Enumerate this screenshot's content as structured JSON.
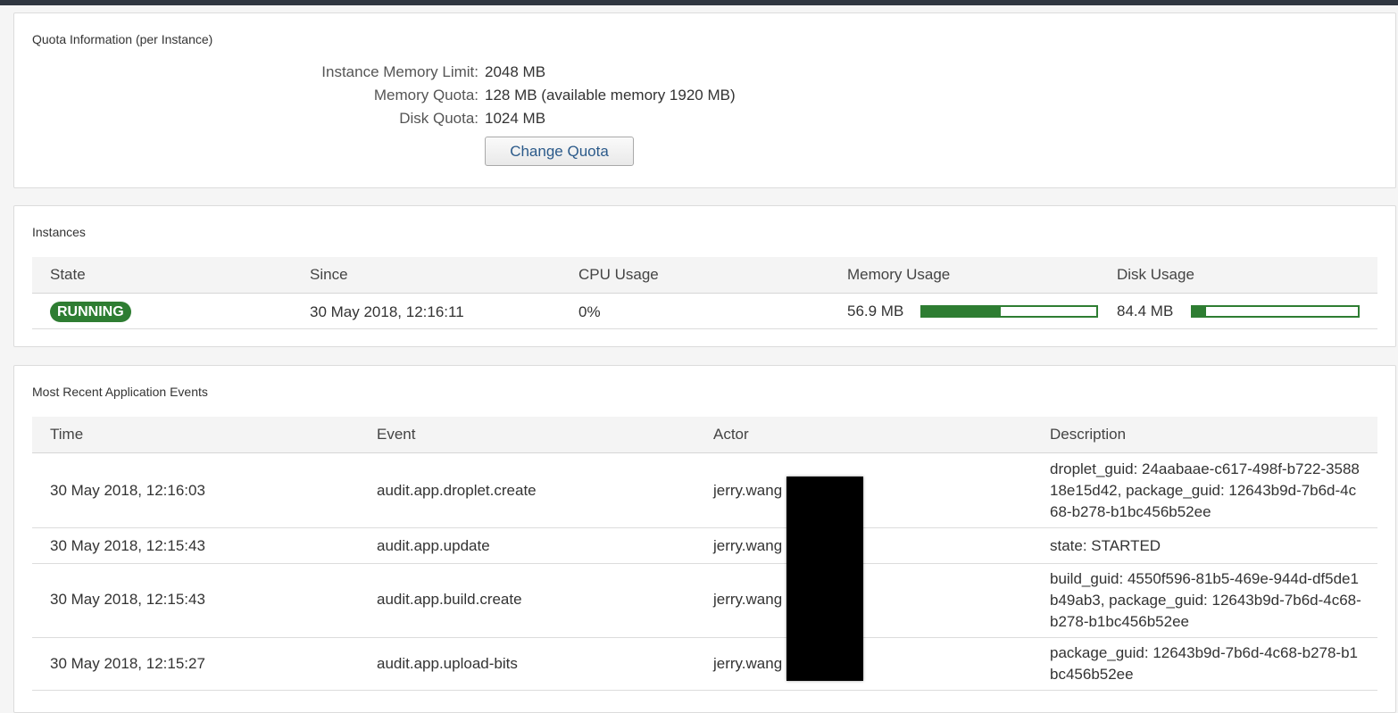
{
  "quota": {
    "title": "Quota Information (per Instance)",
    "rows": [
      {
        "label": "Instance Memory Limit:",
        "value": "2048 MB"
      },
      {
        "label": "Memory Quota:",
        "value": "128 MB (available memory 1920 MB)"
      },
      {
        "label": "Disk Quota:",
        "value": "1024 MB"
      }
    ],
    "change_button": "Change Quota"
  },
  "instances": {
    "title": "Instances",
    "columns": [
      "State",
      "Since",
      "CPU Usage",
      "Memory Usage",
      "Disk Usage"
    ],
    "rows": [
      {
        "state": "RUNNING",
        "since": "30 May 2018, 12:16:11",
        "cpu": "0%",
        "memory": "56.9 MB",
        "memory_fraction": 0.45,
        "disk": "84.4 MB",
        "disk_fraction": 0.08
      }
    ],
    "colors": {
      "running": "#2e7d32"
    }
  },
  "events": {
    "title": "Most Recent Application Events",
    "columns": [
      "Time",
      "Event",
      "Actor",
      "Description"
    ],
    "rows": [
      {
        "time": "30 May 2018, 12:16:03",
        "event": "audit.app.droplet.create",
        "actor": "jerry.wang",
        "description": "droplet_guid: 24aabaae-c617-498f-b722-358818e15d42, package_guid: 12643b9d-7b6d-4c68-b278-b1bc456b52ee"
      },
      {
        "time": "30 May 2018, 12:15:43",
        "event": "audit.app.update",
        "actor": "jerry.wang",
        "description": "state: STARTED"
      },
      {
        "time": "30 May 2018, 12:15:43",
        "event": "audit.app.build.create",
        "actor": "jerry.wang",
        "description": "build_guid: 4550f596-81b5-469e-944d-df5de1b49ab3, package_guid: 12643b9d-7b6d-4c68-b278-b1bc456b52ee"
      },
      {
        "time": "30 May 2018, 12:15:27",
        "event": "audit.app.upload-bits",
        "actor": "jerry.wang",
        "description": "package_guid: 12643b9d-7b6d-4c68-b278-b1bc456b52ee"
      }
    ]
  }
}
